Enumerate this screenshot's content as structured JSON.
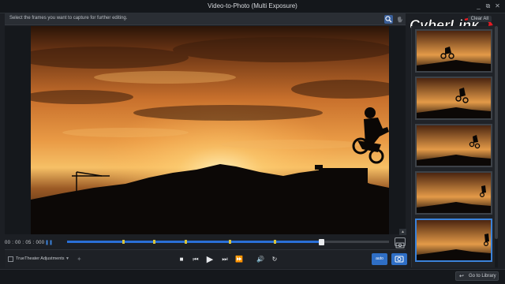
{
  "window": {
    "title": "Video-to-Photo (Multi Exposure)",
    "minimize_icon": "minimize-icon",
    "restore_icon": "restore-icon",
    "close_icon": "close-icon"
  },
  "toolbar": {
    "instruction": "Select the frames you want to capture for further editing.",
    "zoom_icon": "magnifier-icon",
    "hand_icon": "hand-icon"
  },
  "brand": {
    "logo_text": "CyberLink",
    "accent": "#e41b23"
  },
  "frames_panel": {
    "clear_all_label": "Clear All",
    "frame_count": 5,
    "selected_index": 4
  },
  "timeline": {
    "timecode": "00 : 00 : 05 : 000",
    "progress_fraction": 0.79,
    "accent": "#2a6fd6",
    "marker_color": "#d8c33a"
  },
  "controls": {
    "truetheater_label": "TrueTheater Adjustments",
    "stop_icon": "stop-icon",
    "prev_frame_icon": "previous-frame-icon",
    "play_icon": "play-icon",
    "next_frame_icon": "next-frame-icon",
    "fast_forward_icon": "fast-forward-icon",
    "volume_icon": "volume-icon",
    "rotate_icon": "rotate-icon",
    "auto_capture_label": "auto",
    "capture_icon": "camera-icon"
  },
  "footer": {
    "go_to_library_label": "Go to Library"
  }
}
